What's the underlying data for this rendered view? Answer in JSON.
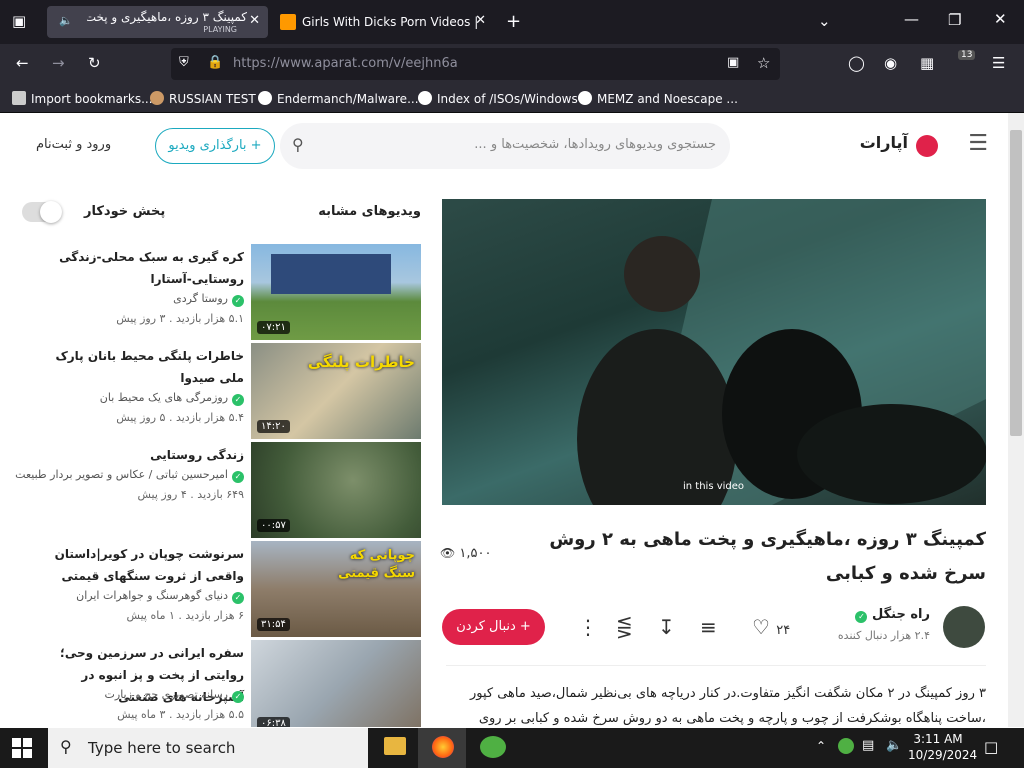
{
  "browser": {
    "tabs": [
      {
        "title": "کمپینگ ۳ روزه ،ماهیگیری و پخت",
        "subtitle": "PLAYING"
      },
      {
        "title": "Girls With Dicks Porn Videos | P"
      }
    ],
    "url": "https://www.aparat.com/v/eejhn6a",
    "extensions_badge": "13",
    "bookmarks": [
      "Import bookmarks...",
      "RUSSIAN TEST",
      "Endermanch/Malware...",
      "Index of /ISOs/Windows",
      "MEMZ and Noescape ..."
    ],
    "icons": [
      "speaker-icon",
      "close-icon",
      "back-icon",
      "forward-icon",
      "reload-icon",
      "shield-icon",
      "lock-icon",
      "star-icon",
      "pocket-icon",
      "account-icon",
      "extensions-icon",
      "menu-icon"
    ]
  },
  "site": {
    "logo": "آپارات",
    "search_placeholder": "جستجوی ویدیوهای رویدادها، شخصیت‌ها و ...",
    "upload_label": "+ بارگذاری ویدیو",
    "login_label": "ورود و ثبت‌نام"
  },
  "video": {
    "overlay_caption": "in this video",
    "title": "کمپینگ ۳ روزه ،ماهیگیری و پخت ماهی به ۲ روش سرخ شده و کبابی",
    "views": "۱,۵۰۰",
    "likes": "۲۴",
    "channel_name": "راه جنگل",
    "channel_followers": "۲.۴ هزار دنبال کننده",
    "follow_label": "+ دنبال کردن",
    "description": "۳ روز کمپینگ در ۲ مکان شگفت انگیز متفاوت.در کنار دریاچه های بی‌نظیر شمال،صید ماهی کپور ،ساخت پناهگاه بوشکرفت از چوب و پارچه و پخت ماهی به دو روش سرخ شده و کبابی بر روی"
  },
  "sidebar": {
    "title": "ویدیوهای مشابه",
    "autoplay_label": "پخش خودکار",
    "autoplay_on": false,
    "videos": [
      {
        "title": "کره گیری به سبک محلی-زندگی روستایی-آستارا",
        "channel": "روستا گردی",
        "views": "۵.۱ هزار بازدید",
        "age": "۳ روز پیش",
        "duration": "۰۷:۲۱"
      },
      {
        "title": "خاطرات پلنگی محیط بانان پارک ملی صیدوا",
        "channel": "روزمرگی های یک محیط بان",
        "views": "۵.۴ هزار بازدید",
        "age": "۵ روز پیش",
        "duration": "۱۴:۲۰",
        "thumb_text": "خاطرات پلنگی"
      },
      {
        "title": "زندگی روستایی",
        "channel": "امیرحسین ثباتی / عکاس و تصویر بردار طبیعت",
        "views": "۶۴۹ بازدید",
        "age": "۴ روز پیش",
        "duration": "۰۰:۵۷"
      },
      {
        "title": "سرنوشت چوپان در کویر|داستان واقعی از ثروت سنگهای قیمتی",
        "channel": "دنیای گوهرسنگ و جواهرات ایران",
        "views": "۶ هزار بازدید",
        "age": "۱ ماه پیش",
        "duration": "۳۱:۵۴",
        "thumb_text": "چوپانی که سنگ قیمتی"
      },
      {
        "title": "سفره ایرانی در سرزمین وحی؛ روایتی از پخت و پز انبوه در آشپزخانه های صنعتی",
        "channel": "رسانه تصویری حج و زیارت",
        "views": "۵.۵ هزار بازدید",
        "age": "۳ ماه پیش",
        "duration": "۰۶:۳۸"
      }
    ]
  },
  "taskbar": {
    "search_placeholder": "Type here to search",
    "time": "3:11 AM",
    "date": "10/29/2024"
  },
  "colors": {
    "accent": "#1ba9bf",
    "follow": "#e0224a",
    "verified": "#2bc169",
    "browser_bg": "#1c1b22"
  }
}
